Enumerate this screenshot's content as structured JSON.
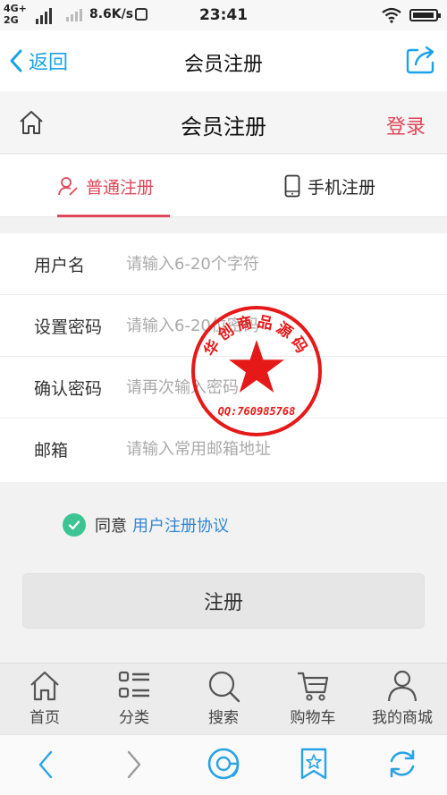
{
  "status_bar": {
    "network_top": "4G+",
    "network_bottom": "2G",
    "speed": "8.6K/s",
    "time": "23:41"
  },
  "nav": {
    "back_label": "返回",
    "title": "会员注册"
  },
  "page_header": {
    "title": "会员注册",
    "login_label": "登录"
  },
  "tabs": [
    {
      "label": "普通注册",
      "active": true
    },
    {
      "label": "手机注册",
      "active": false
    }
  ],
  "form": {
    "fields": [
      {
        "label": "用户名",
        "placeholder": "请输入6-20个字符",
        "value": ""
      },
      {
        "label": "设置密码",
        "placeholder": "请输入6-20位密码",
        "value": ""
      },
      {
        "label": "确认密码",
        "placeholder": "请再次输入密码",
        "value": ""
      },
      {
        "label": "邮箱",
        "placeholder": "请输入常用邮箱地址",
        "value": ""
      }
    ],
    "agree_text": "同意",
    "agree_link": "用户注册协议",
    "agree_checked": true,
    "submit_label": "注册"
  },
  "bottom_nav": [
    {
      "label": "首页",
      "icon": "home-icon"
    },
    {
      "label": "分类",
      "icon": "category-list-icon"
    },
    {
      "label": "搜索",
      "icon": "search-icon"
    },
    {
      "label": "购物车",
      "icon": "cart-icon"
    },
    {
      "label": "我的商城",
      "icon": "user-icon"
    }
  ],
  "seal": {
    "text": "华创商品源码",
    "contact": "QQ:760985768"
  },
  "colors": {
    "accent_red": "#e0475a",
    "link_blue": "#2f86d8",
    "nav_blue": "#1aa3e8",
    "check_green": "#3dc493",
    "seal_red": "#e61919"
  }
}
